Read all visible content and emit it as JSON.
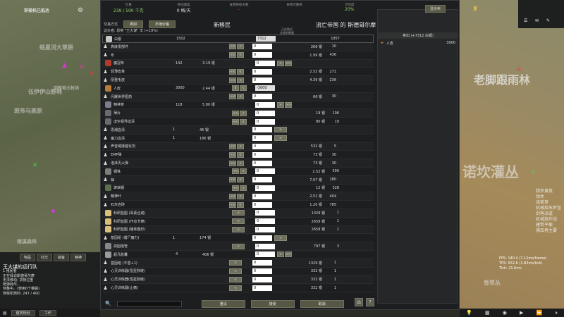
{
  "map": {
    "labels_left": [
      "穿梭机已抵达",
      "蛀星河大草原",
      "伍伊伊山野林",
      "回家地大牧场",
      "斑帝马高原",
      "雨溪森林",
      "诺坎灌"
    ],
    "labels_right": [
      "老脚跟雨林",
      "诺坎灌丛",
      "香草丛",
      "诺坎灌丛"
    ],
    "right_notes": [
      "猎杀黄鼠",
      "伐木",
      "烧茶草",
      "机械族朱梦宣",
      "剑客派遣",
      "机械族作战",
      "建筑平衡",
      "捕虫者主要"
    ]
  },
  "topbar": {
    "stats": [
      {
        "label": "负重",
        "value": "239 / 500 千克",
        "money": true
      },
      {
        "label": "移动速度",
        "value": "0 格/天",
        "money": false
      },
      {
        "label": "食物供给天数",
        "value": "-",
        "money": false
      },
      {
        "label": "食物可维持",
        "value": "",
        "money": false
      },
      {
        "label": "可见度",
        "value": "20%",
        "money": true
      }
    ]
  },
  "header": {
    "trade_mode_label": "交易方式",
    "tab1": "类别",
    "tab2": "市场价格",
    "settlement_title": "新移民",
    "trader_title": "流亡帝国 的 斯德哥尔摩",
    "trade_with": "议价者: 恩英 \"王大谋\" 辛 (+19%)",
    "col_header_line1": "正在购买",
    "col_header_line2": "交易的数量"
  },
  "rows": [
    {
      "icon_color": "#c7c7c7",
      "kind": "silver",
      "name": "白银",
      "colony_qty": "1502",
      "price": "",
      "input": "7312",
      "trader_price": "",
      "trader_qty": "1857",
      "left_btns": "",
      "right_btns": ""
    },
    {
      "icon_color": "",
      "kind": "pawn",
      "name": "高级零部件",
      "colony_qty": "",
      "price": "",
      "input": "0",
      "trader_price": "266 银",
      "trader_qty": "10",
      "left_btns": "<< <",
      "right_btns": ""
    },
    {
      "icon_color": "",
      "kind": "pawn",
      "name": "布",
      "colony_qty": "",
      "price": "",
      "input": "0",
      "trader_price": "1.99 银",
      "trader_qty": "436",
      "left_btns": "<< <",
      "right_btns": ""
    },
    {
      "icon_color": "#b23a2a",
      "kind": "item",
      "name": "魔冠布",
      "colony_qty": "142",
      "price": "3.19 银",
      "input": "0",
      "trader_price": "",
      "trader_qty": "",
      "left_btns": "",
      "right_btns": "> >>"
    },
    {
      "icon_color": "",
      "kind": "pawn",
      "name": "轻薄皮革",
      "colony_qty": "",
      "price": "",
      "input": "0",
      "trader_price": "2.52 银",
      "trader_qty": "271",
      "left_btns": "<< <",
      "right_btns": ""
    },
    {
      "icon_color": "",
      "kind": "pawn",
      "name": "厚重毛皮",
      "colony_qty": "",
      "price": "",
      "input": "0",
      "trader_price": "4.39 银",
      "trader_qty": "236",
      "left_btns": "<< <",
      "right_btns": ""
    },
    {
      "icon_color": "#b87a3a",
      "kind": "item",
      "name": "人皮",
      "colony_qty": "3000",
      "price": "2.44 银",
      "input": "-3000",
      "trader_price": "",
      "trader_qty": "",
      "left_btns": "0 <",
      "right_btns": ""
    },
    {
      "icon_color": "",
      "kind": "pawn",
      "name": "闪耀世界医药",
      "colony_qty": "",
      "price": "",
      "input": "0",
      "trader_price": "66 银",
      "trader_qty": "30",
      "left_btns": "<< <",
      "right_btns": ""
    },
    {
      "icon_color": "#7a7f8a",
      "kind": "item",
      "name": "精神茶",
      "colony_qty": "118",
      "price": "5.80 银",
      "input": "0",
      "trader_price": "",
      "trader_qty": "",
      "left_btns": "",
      "right_btns": "> >>"
    },
    {
      "icon_color": "#6a6a70",
      "kind": "item",
      "name": "薄片",
      "colony_qty": "",
      "price": "",
      "input": "0",
      "trader_price": "19 银",
      "trader_qty": "106",
      "left_btns": "<< <",
      "right_btns": ""
    },
    {
      "icon_color": "#6a6a70",
      "kind": "item",
      "name": "虚空视界血清",
      "colony_qty": "",
      "price": "",
      "input": "0",
      "trader_price": "80 银",
      "trader_qty": "19",
      "left_btns": "<< <",
      "right_btns": ""
    },
    {
      "icon_color": "",
      "kind": "pawn",
      "name": "思潮血清",
      "colony_qty": "1",
      "price": "46 银",
      "input": "0",
      "trader_price": "",
      "trader_qty": "",
      "left_btns": "",
      "right_btns": ">"
    },
    {
      "icon_color": "",
      "kind": "pawn",
      "name": "魔力血清",
      "colony_qty": "1",
      "price": "186 银",
      "input": "0",
      "trader_price": "",
      "trader_qty": "",
      "left_btns": "",
      "right_btns": ">"
    },
    {
      "icon_color": "",
      "kind": "pawn",
      "name": "声音链接催化剂",
      "colony_qty": "",
      "price": "",
      "input": "0",
      "trader_price": "532 银",
      "trader_qty": "5",
      "left_btns": "<< <",
      "right_btns": ""
    },
    {
      "icon_color": "",
      "kind": "pawn",
      "name": "EMP弹",
      "colony_qty": "",
      "price": "",
      "input": "0",
      "trader_price": "73 银",
      "trader_qty": "30",
      "left_btns": "<< <",
      "right_btns": ""
    },
    {
      "icon_color": "",
      "kind": "pawn",
      "name": "泡沫灭火弹",
      "colony_qty": "",
      "price": "",
      "input": "0",
      "trader_price": "73 银",
      "trader_qty": "30",
      "left_btns": "<< <",
      "right_btns": ""
    },
    {
      "icon_color": "#7d7d7d",
      "kind": "item",
      "name": "钢铁",
      "colony_qty": "",
      "price": "",
      "input": "0",
      "trader_price": "2.52 银",
      "trader_qty": "590",
      "left_btns": "<< <",
      "right_btns": ""
    },
    {
      "icon_color": "",
      "kind": "pawn",
      "name": "铀",
      "colony_qty": "",
      "price": "",
      "input": "0",
      "trader_price": "7.97 银",
      "trader_qty": "180",
      "left_btns": "<< <",
      "right_btns": ""
    },
    {
      "icon_color": "#5f7052",
      "kind": "item",
      "name": "玻璃钢",
      "colony_qty": "",
      "price": "",
      "input": "0",
      "trader_price": "12 银",
      "trader_qty": "328",
      "left_btns": "<< <",
      "right_btns": ""
    },
    {
      "icon_color": "",
      "kind": "pawn",
      "name": "精神叶",
      "colony_qty": "",
      "price": "",
      "input": "0",
      "trader_price": "2.52 银",
      "trader_qty": "404",
      "left_btns": "<< <",
      "right_btns": ""
    },
    {
      "icon_color": "",
      "kind": "pawn",
      "name": "石灰岩砖",
      "colony_qty": "",
      "price": "",
      "input": "0",
      "trader_price": "1.20 银",
      "trader_qty": "785",
      "left_btns": "<< <",
      "right_btns": ""
    },
    {
      "icon_color": "#d8c07a",
      "kind": "item",
      "name": "科研蓝图 (毒素合成)",
      "colony_qty": "",
      "price": "",
      "input": "0",
      "trader_price": "1329 银",
      "trader_qty": "1",
      "left_btns": "<",
      "right_btns": ""
    },
    {
      "icon_color": "#d8c07a",
      "kind": "item",
      "name": "科研蓝图 (作息节律)",
      "colony_qty": "",
      "price": "",
      "input": "0",
      "trader_price": "2658 银",
      "trader_qty": "1",
      "left_btns": "<",
      "right_btns": ""
    },
    {
      "icon_color": "#d8c07a",
      "kind": "item",
      "name": "科研蓝图 (躯体整形)",
      "colony_qty": "",
      "price": "",
      "input": "0",
      "trader_price": "2658 银",
      "trader_qty": "1",
      "left_btns": "<",
      "right_btns": ""
    },
    {
      "icon_color": "",
      "kind": "pawn",
      "name": "基因组 (僵尸魔力)",
      "colony_qty": "1",
      "price": "174 银",
      "input": "0",
      "trader_price": "",
      "trader_qty": "",
      "left_btns": "",
      "right_btns": ">"
    },
    {
      "icon_color": "#888",
      "kind": "item",
      "name": "如固拖管",
      "colony_qty": "",
      "price": "",
      "input": "0",
      "trader_price": "797 银",
      "trader_qty": "3",
      "left_btns": "<",
      "right_btns": ""
    },
    {
      "icon_color": "#9a9a9a",
      "kind": "silver",
      "name": "超凡胶囊",
      "colony_qty": "4",
      "price": "406 银",
      "input": "0",
      "trader_price": "",
      "trader_qty": "",
      "left_btns": "",
      "right_btns": "> >>"
    },
    {
      "icon_color": "",
      "kind": "pawn",
      "name": "基因组 (不善+1)",
      "colony_qty": "",
      "price": "",
      "input": "0",
      "trader_price": "1329 银",
      "trader_qty": "1",
      "left_btns": "<",
      "right_btns": ""
    },
    {
      "icon_color": "",
      "kind": "pawn",
      "name": "心灵训练器(恒星脉链)",
      "colony_qty": "",
      "price": "",
      "input": "0",
      "trader_price": "332 银",
      "trader_qty": "1",
      "left_btns": "<",
      "right_btns": ""
    },
    {
      "icon_color": "",
      "kind": "pawn",
      "name": "心灵训练器(恒星脉链)",
      "colony_qty": "",
      "price": "",
      "input": "0",
      "trader_price": "332 银",
      "trader_qty": "1",
      "left_btns": "<",
      "right_btns": ""
    },
    {
      "icon_color": "",
      "kind": "pawn",
      "name": "心灵训练器(止痛)",
      "colony_qty": "",
      "price": "",
      "input": "0",
      "trader_price": "332 银",
      "trader_qty": "1",
      "left_btns": "<",
      "right_btns": ""
    }
  ],
  "bottom": {
    "reset": "重设",
    "accept": "接受",
    "cancel": "取消"
  },
  "side": {
    "top_button": "显示卖",
    "sell_header": "卖出 (+7312 白银)",
    "item_name": "人皮",
    "item_qty": "3000"
  },
  "left_panel": {
    "tabs": [
      "物品",
      "社交",
      "装备",
      "精神"
    ],
    "caravan_title": "王大谋的远行队",
    "caravan_lines": [
      "1 殖民者",
      "正在拜访斯德哥尔摩",
      "无法移动: 货物过重",
      "枪弹耗尽。",
      "休整中。(使用0个棚袋)",
      "穿梭机燃料: 247 / 400"
    ],
    "bottom_tabs": [
      "建筑规划",
      "工作"
    ]
  },
  "right_top": {
    "icon1": "☰",
    "icon2": "✉",
    "icon3": "✎"
  },
  "fps": {
    "line1": "FPS: 140.4 (7.12ms/frame)",
    "line2": "TPS: 552.6 (1.82ms/tick)",
    "line3": "Tick: 21.6ms"
  }
}
